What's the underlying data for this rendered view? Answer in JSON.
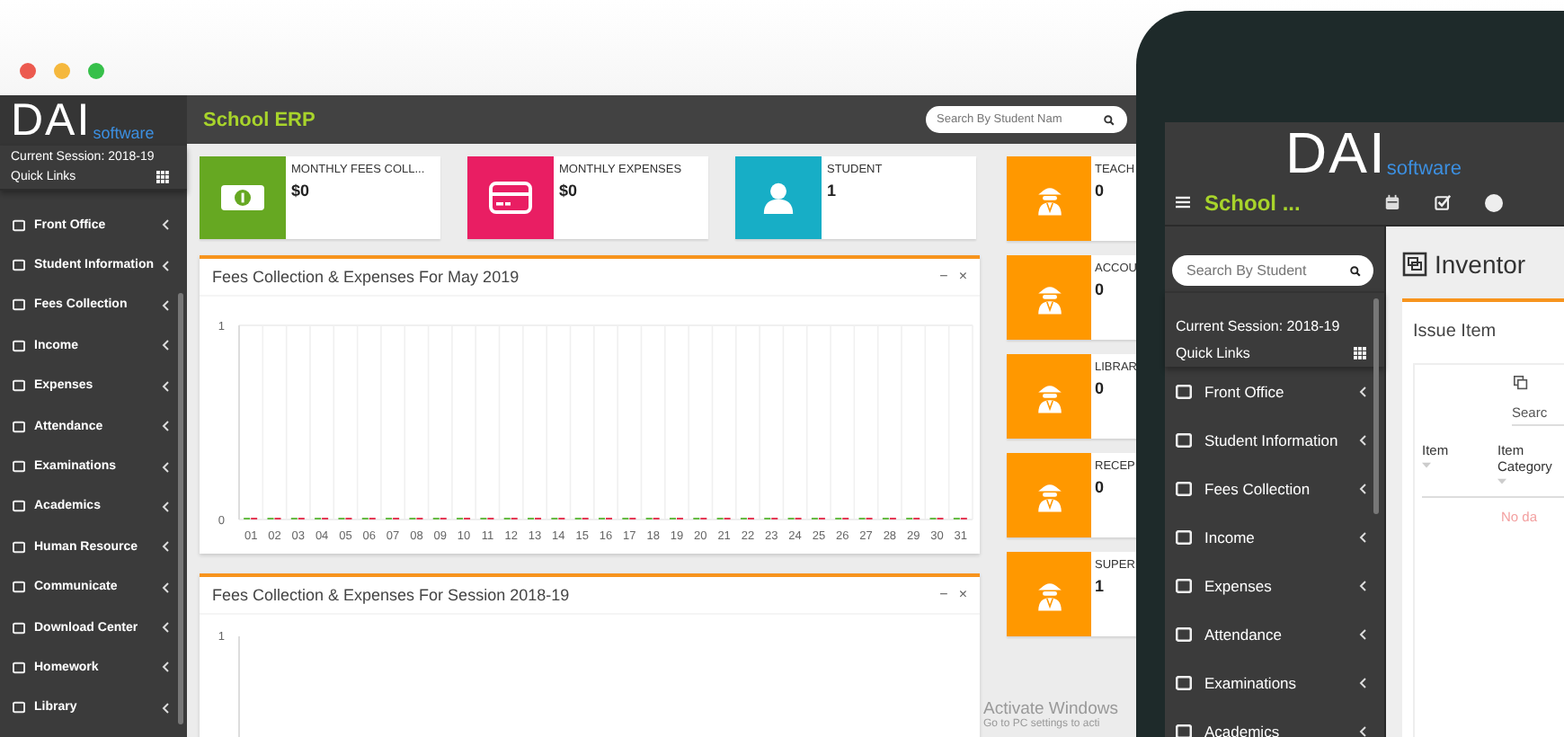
{
  "browser": {
    "dots": [
      {
        "color": "#ec5a4f"
      },
      {
        "color": "#f5b83d"
      },
      {
        "color": "#36c04a"
      }
    ]
  },
  "desktop": {
    "logo": {
      "main": "DAI",
      "sub": "software"
    },
    "session": "Current Session: 2018-19",
    "quick_links": "Quick Links",
    "menu": [
      {
        "label": "Front Office"
      },
      {
        "label": "Student Information"
      },
      {
        "label": "Fees Collection"
      },
      {
        "label": "Income"
      },
      {
        "label": "Expenses"
      },
      {
        "label": "Attendance"
      },
      {
        "label": "Examinations"
      },
      {
        "label": "Academics"
      },
      {
        "label": "Human Resource"
      },
      {
        "label": "Communicate"
      },
      {
        "label": "Download Center"
      },
      {
        "label": "Homework"
      },
      {
        "label": "Library"
      }
    ],
    "app_title": "School ERP",
    "search": {
      "placeholder": "Search By Student Nam"
    },
    "stat_cards": [
      {
        "kind": "money",
        "label": "MONTHLY FEES COLL...",
        "value": "$0",
        "color": "#66a822"
      },
      {
        "kind": "card",
        "label": "MONTHLY EXPENSES",
        "value": "$0",
        "color": "#e91e63"
      },
      {
        "kind": "person",
        "label": "STUDENT",
        "value": "1",
        "color": "#17aec6"
      }
    ],
    "staff_cards": [
      {
        "kind": "spy",
        "label": "TEACH",
        "value": "0",
        "color": "#ff9800"
      },
      {
        "kind": "spy",
        "label": "ACCOU",
        "value": "0",
        "color": "#ff9800"
      },
      {
        "kind": "spy",
        "label": "LIBRAR",
        "value": "0",
        "color": "#ff9800"
      },
      {
        "kind": "spy",
        "label": "RECEP",
        "value": "0",
        "color": "#ff9800"
      },
      {
        "kind": "spy",
        "label": "SUPER",
        "value": "1",
        "color": "#ff9800"
      }
    ],
    "panels": [
      {
        "title": "Fees Collection & Expenses For May 2019",
        "controls": [
          "−",
          "×"
        ],
        "chart_data": {
          "type": "bar",
          "categories": [
            "01",
            "02",
            "03",
            "04",
            "05",
            "06",
            "07",
            "08",
            "09",
            "10",
            "11",
            "12",
            "13",
            "14",
            "15",
            "16",
            "17",
            "18",
            "19",
            "20",
            "21",
            "22",
            "23",
            "24",
            "25",
            "26",
            "27",
            "28",
            "29",
            "30",
            "31"
          ],
          "series": [
            {
              "color": "#66bb44",
              "values": [
                0,
                0,
                0,
                0,
                0,
                0,
                0,
                0,
                0,
                0,
                0,
                0,
                0,
                0,
                0,
                0,
                0,
                0,
                0,
                0,
                0,
                0,
                0,
                0,
                0,
                0,
                0,
                0,
                0,
                0,
                0
              ]
            },
            {
              "color": "#e53955",
              "values": [
                0,
                0,
                0,
                0,
                0,
                0,
                0,
                0,
                0,
                0,
                0,
                0,
                0,
                0,
                0,
                0,
                0,
                0,
                0,
                0,
                0,
                0,
                0,
                0,
                0,
                0,
                0,
                0,
                0,
                0,
                0
              ]
            }
          ],
          "ylim": [
            0,
            1
          ],
          "yticks": [
            0,
            1
          ]
        }
      },
      {
        "title": "Fees Collection & Expenses For Session 2018-19",
        "controls": [
          "−",
          "×"
        ],
        "axis_label": "1"
      }
    ],
    "os_notice": [
      "Activate Windows",
      "Go to PC settings to acti"
    ]
  },
  "phone": {
    "logo": {
      "main": "DAI",
      "sub": "software"
    },
    "app_title": "School ...",
    "search": {
      "placeholder": "Search By Student"
    },
    "session": "Current Session: 2018-19",
    "quick_links": "Quick Links",
    "menu": [
      {
        "label": "Front Office"
      },
      {
        "label": "Student Information"
      },
      {
        "label": "Fees Collection"
      },
      {
        "label": "Income"
      },
      {
        "label": "Expenses"
      },
      {
        "label": "Attendance"
      },
      {
        "label": "Examinations"
      },
      {
        "label": "Academics"
      }
    ],
    "page_title": "Inventor",
    "card_title": "Issue Item",
    "table_search": "Searc",
    "columns": [
      "Item",
      "Item Category"
    ],
    "empty_text": "No da"
  }
}
